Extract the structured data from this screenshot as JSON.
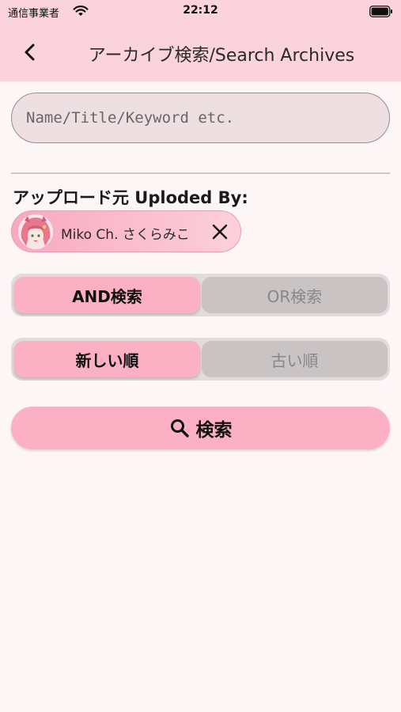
{
  "status_bar": {
    "carrier": "通信事業者",
    "time": "22:12"
  },
  "header": {
    "title": "アーカイブ検索/Search Archives",
    "back_icon": "chevron-left-icon"
  },
  "search": {
    "placeholder": "Name/Title/Keyword etc.",
    "value": ""
  },
  "uploader": {
    "heading": "アップロード元 Uploded By:",
    "chip_label": "Miko Ch. さくらみこ",
    "close_icon": "close-icon"
  },
  "match_mode": {
    "options": [
      "AND検索",
      "OR検索"
    ],
    "selected": "AND検索"
  },
  "sort_order": {
    "options": [
      "新しい順",
      "古い順"
    ],
    "selected": "新しい順"
  },
  "search_button": {
    "label": "検索",
    "icon": "search-icon"
  },
  "colors": {
    "header_bg": "#fbd3dc",
    "page_bg": "#fdf6f7",
    "accent_pink": "#fbb1c3",
    "inactive_gray": "#c9c3c4"
  }
}
